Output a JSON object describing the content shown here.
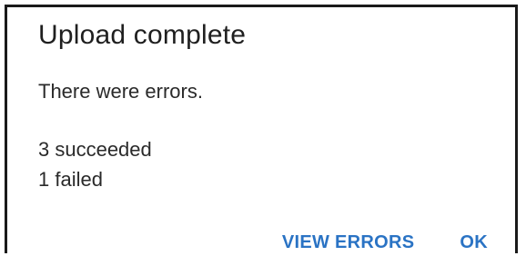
{
  "dialog": {
    "title": "Upload complete",
    "message": "There were errors.",
    "details": {
      "succeeded": "3 succeeded",
      "failed": "1 failed"
    },
    "actions": {
      "view_errors_label": "VIEW ERRORS",
      "ok_label": "OK"
    }
  },
  "colors": {
    "accent": "#2a73c4",
    "text": "#202020",
    "border": "#1a1a1a"
  }
}
